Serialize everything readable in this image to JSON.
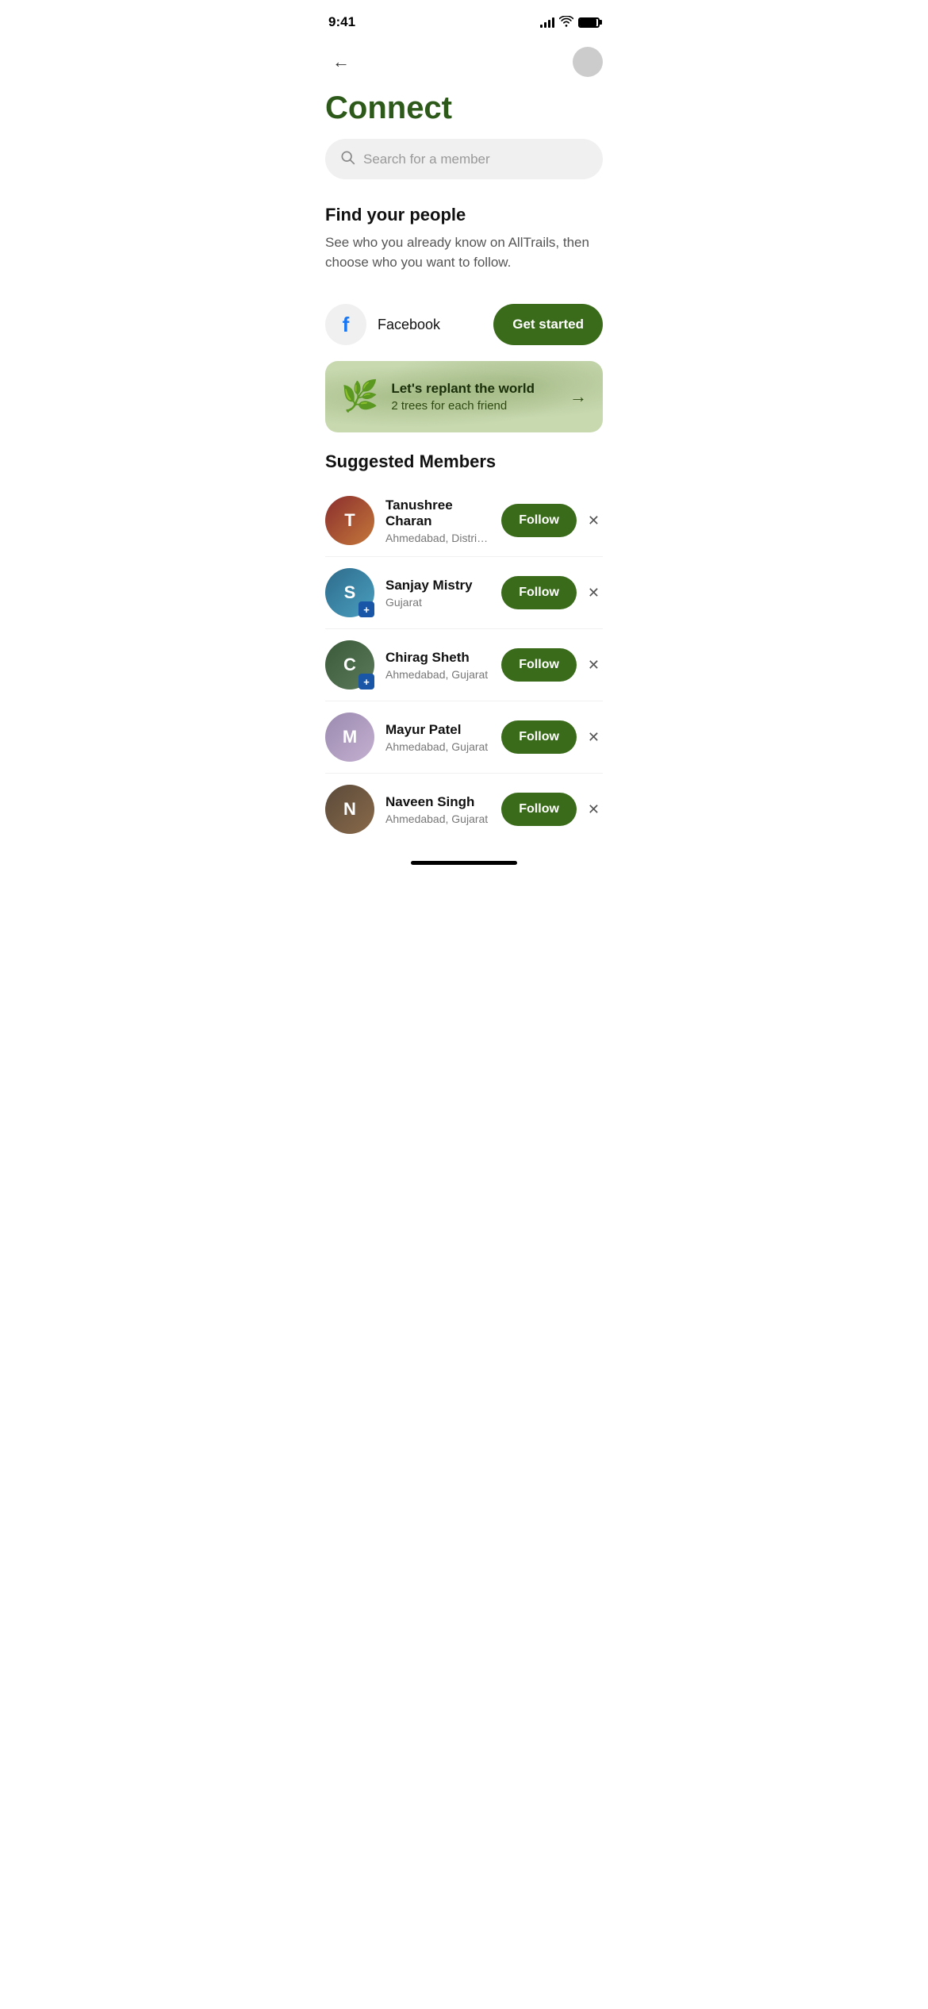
{
  "statusBar": {
    "time": "9:41"
  },
  "header": {
    "back_label": "back"
  },
  "page": {
    "title": "Connect"
  },
  "search": {
    "placeholder": "Search for a member"
  },
  "findPeople": {
    "title": "Find your people",
    "description": "See who you already know on AllTrails, then choose who you want to follow.",
    "facebookLabel": "Facebook",
    "getStartedLabel": "Get started"
  },
  "replantBanner": {
    "title": "Let's replant the world",
    "subtitle": "2 trees for each friend"
  },
  "suggestedMembers": {
    "sectionTitle": "Suggested Members",
    "members": [
      {
        "name": "Tanushree Charan",
        "location": "Ahmedabad, District of Colu...",
        "hasBadge": false,
        "avatarInitial": "T",
        "avatarClass": "avatar-tanushree"
      },
      {
        "name": "Sanjay Mistry",
        "location": "Gujarat",
        "hasBadge": true,
        "avatarInitial": "S",
        "avatarClass": "avatar-sanjay"
      },
      {
        "name": "Chirag Sheth",
        "location": "Ahmedabad, Gujarat",
        "hasBadge": true,
        "avatarInitial": "C",
        "avatarClass": "avatar-chirag"
      },
      {
        "name": "Mayur Patel",
        "location": "Ahmedabad, Gujarat",
        "hasBadge": false,
        "avatarInitial": "M",
        "avatarClass": "avatar-mayur"
      },
      {
        "name": "Naveen Singh",
        "location": "Ahmedabad, Gujarat",
        "hasBadge": false,
        "avatarInitial": "N",
        "avatarClass": "avatar-naveen"
      }
    ],
    "followLabel": "Follow",
    "dismissLabel": "✕"
  }
}
